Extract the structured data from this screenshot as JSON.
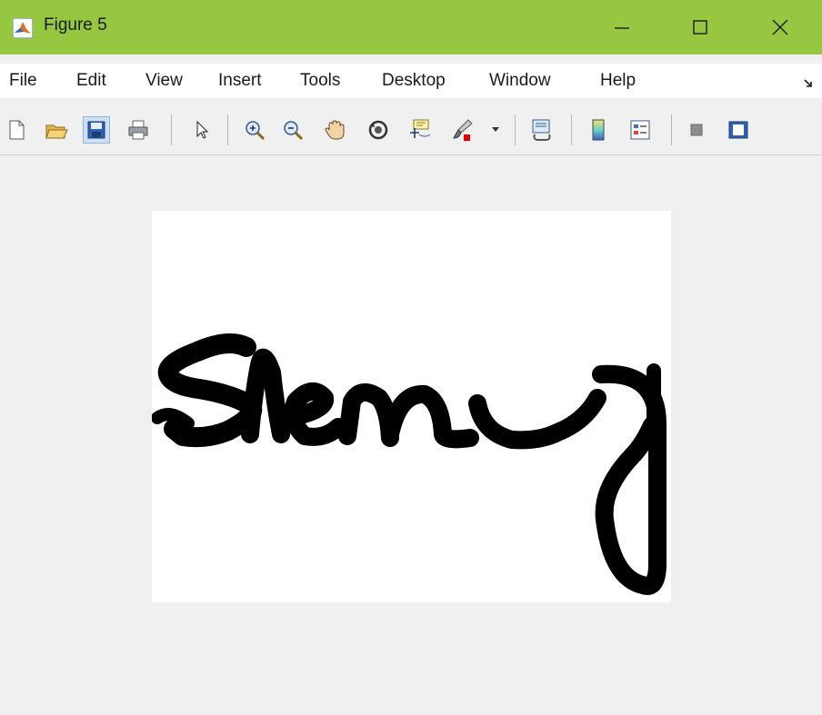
{
  "window": {
    "title": "Figure 5",
    "icon": "matlab-icon",
    "controls": [
      "minimize-icon",
      "maximize-icon",
      "close-icon"
    ],
    "titlebar_color": "#95c740"
  },
  "menu": {
    "items": [
      "File",
      "Edit",
      "View",
      "Insert",
      "Tools",
      "Desktop",
      "Window",
      "Help"
    ],
    "overflow_icon": "dock-arrow-icon"
  },
  "toolbar": {
    "buttons": [
      "new-figure-icon",
      "open-file-icon",
      "save-icon",
      "print-icon",
      "edit-plot-icon",
      "zoom-in-icon",
      "zoom-out-icon",
      "pan-icon",
      "rotate-3d-icon",
      "data-cursor-icon",
      "brush-icon",
      "link-plot-icon",
      "insert-colorbar-icon",
      "insert-legend-icon",
      "hide-plot-tools-icon",
      "show-plot-tools-icon"
    ],
    "pressed": "save-icon"
  },
  "figure": {
    "image": "handwritten-signature",
    "background": "#ffffff",
    "ink_color": "#000000"
  }
}
